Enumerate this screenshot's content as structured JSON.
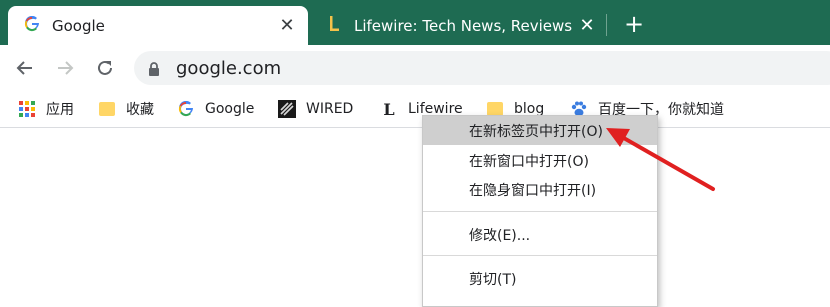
{
  "colors": {
    "tabstrip_bg": "#1e6b52",
    "active_tab_bg": "#ffffff",
    "menu_highlight": "#cfcfcf",
    "arrow": "#e02020"
  },
  "tabs": [
    {
      "title": "Google",
      "icon": "google-g-icon",
      "active": true
    },
    {
      "title": "Lifewire: Tech News, Reviews, H",
      "icon": "lifewire-l-icon",
      "active": false
    }
  ],
  "toolbar": {
    "url": "google.com"
  },
  "bookmarks": [
    {
      "label": "应用",
      "icon": "apps-grid-icon"
    },
    {
      "label": "收藏",
      "icon": "folder-icon"
    },
    {
      "label": "Google",
      "icon": "google-g-icon"
    },
    {
      "label": "WIRED",
      "icon": "wired-icon"
    },
    {
      "label": "Lifewire",
      "icon": "lifewire-l-icon"
    },
    {
      "label": "blog",
      "icon": "folder-icon"
    },
    {
      "label": "百度一下，你就知道",
      "icon": "baidu-paw-icon"
    }
  ],
  "context_menu": {
    "items": [
      {
        "label": "在新标签页中打开(O)",
        "highlighted": true
      },
      {
        "label": "在新窗口中打开(O)",
        "highlighted": false
      },
      {
        "label": "在隐身窗口中打开(I)",
        "highlighted": false
      },
      {
        "label": "修改(E)...",
        "highlighted": false
      },
      {
        "label": "剪切(T)",
        "highlighted": false
      }
    ]
  }
}
